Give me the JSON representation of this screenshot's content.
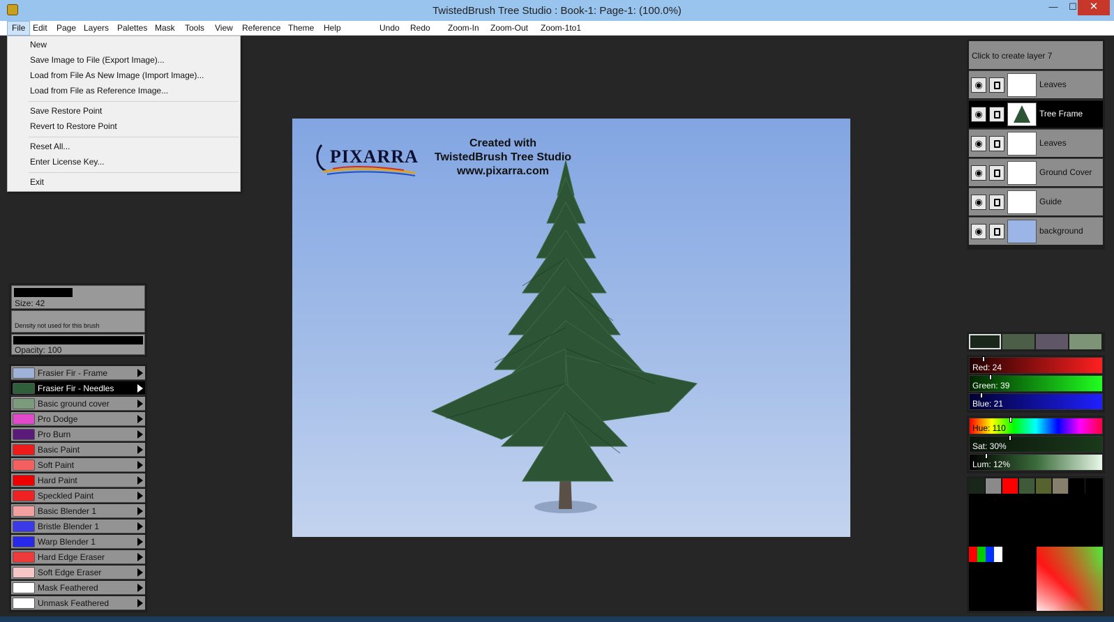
{
  "window": {
    "title": "TwistedBrush Tree Studio : Book-1: Page-1:  (100.0%)",
    "minimize": "—",
    "maximize": "☐",
    "close": "✕"
  },
  "menubar": [
    "File",
    "Edit",
    "Page",
    "Layers",
    "Palettes",
    "Mask",
    "Tools",
    "View",
    "Reference",
    "Theme",
    "Help"
  ],
  "toolbar": {
    "undo": "Undo",
    "redo": "Redo",
    "zoom_in": "Zoom-In",
    "zoom_out": "Zoom-Out",
    "zoom_1to1": "Zoom-1to1"
  },
  "file_menu": {
    "items": [
      "New",
      "Save Image to File (Export Image)...",
      "Load from File As New Image (Import Image)...",
      "Load from File as Reference Image...",
      "Save Restore Point",
      "Revert to Restore Point",
      "Reset All...",
      "Enter License Key...",
      "Exit"
    ]
  },
  "canvas": {
    "logo": "PIXARRA",
    "credit": [
      "Created with",
      "TwistedBrush Tree Studio",
      "www.pixarra.com"
    ]
  },
  "brush_props": {
    "size": "Size: 42",
    "density": "Density not used for this brush",
    "opacity": "Opacity: 100"
  },
  "brushes": [
    {
      "label": "Frasier Fir - Frame",
      "thumb": "#9fb3d8",
      "selected": false
    },
    {
      "label": "Frasier Fir - Needles",
      "thumb": "#2f5f3a",
      "selected": true
    },
    {
      "label": "Basic ground cover",
      "thumb": "#7c9a7c",
      "selected": false
    },
    {
      "label": "Pro Dodge",
      "thumb": "#e04acb",
      "selected": false
    },
    {
      "label": "Pro Burn",
      "thumb": "#5a1a7a",
      "selected": false
    },
    {
      "label": "Basic Paint",
      "thumb": "#ee1b1b",
      "selected": false
    },
    {
      "label": "Soft Paint",
      "thumb": "#f46060",
      "selected": false
    },
    {
      "label": "Hard Paint",
      "thumb": "#ee0000",
      "selected": false
    },
    {
      "label": "Speckled Paint",
      "thumb": "#ee2222",
      "selected": false
    },
    {
      "label": "Basic Blender 1",
      "thumb": "#f4a0a0",
      "selected": false
    },
    {
      "label": "Bristle Blender 1",
      "thumb": "#3a3ae8",
      "selected": false
    },
    {
      "label": "Warp Blender 1",
      "thumb": "#2828e8",
      "selected": false
    },
    {
      "label": "Hard Edge Eraser",
      "thumb": "#ee3a3a",
      "selected": false
    },
    {
      "label": "Soft Edge Eraser",
      "thumb": "#f7c7c7",
      "selected": false
    },
    {
      "label": "Mask Feathered",
      "thumb": "#ffffff",
      "selected": false
    },
    {
      "label": "Unmask Feathered",
      "thumb": "#ffffff",
      "selected": false
    }
  ],
  "layers": {
    "create": "Click to create layer 7",
    "items": [
      {
        "name": "Leaves",
        "selected": false
      },
      {
        "name": "Tree Frame",
        "selected": true
      },
      {
        "name": "Leaves",
        "selected": false
      },
      {
        "name": "Ground Cover",
        "selected": false
      },
      {
        "name": "Guide",
        "selected": false
      },
      {
        "name": "background",
        "selected": false
      }
    ]
  },
  "color": {
    "swatches": [
      "#18271a",
      "#4c5e48",
      "#5f5768",
      "#7d9576"
    ],
    "red": "Red: 24",
    "green": "Green: 39",
    "blue": "Blue: 21",
    "hue": "Hue: 110",
    "sat": "Sat: 30%",
    "lum": "Lum: 12%",
    "red_value": 24,
    "green_value": 39,
    "blue_value": 21,
    "hue_value": 110,
    "sat_value": 30,
    "lum_value": 12,
    "palette": [
      "#18271a",
      "#8a8a8a",
      "#ff0000",
      "#3e5a38",
      "#56632e",
      "#857f6c",
      "#000000"
    ]
  }
}
